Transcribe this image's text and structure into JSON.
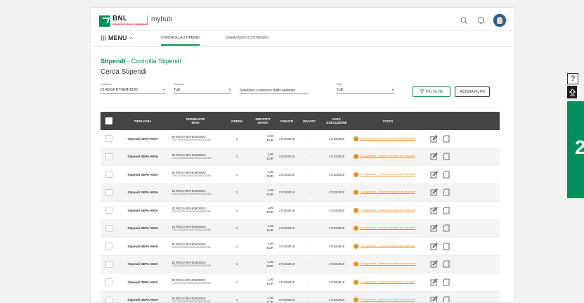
{
  "header": {
    "logo_text": "BNL",
    "logo_sub": "GRUPPO BNP PARIBAS",
    "app_name": "myhub",
    "icons": [
      "search-icon",
      "bell-icon",
      "avatar"
    ]
  },
  "nav": {
    "menu_label": "MENU",
    "tabs": [
      {
        "label": "CONTROLLA STIPENDI",
        "active": true
      },
      {
        "label": "CREA NUOVO STIPENDIO",
        "active": false
      }
    ]
  },
  "page": {
    "breadcrumb_main": "Stipendi",
    "breadcrumb_sub": "- Controlla Stipendi",
    "heading": "Cerca Stipendi"
  },
  "filters": {
    "ordinante_label": "Ordinante",
    "ordinante_value": "DI REGA BYHEMOBJO",
    "tipologia_label": "Tipologia",
    "tipologia_value": "Tutti",
    "iban_placeholder": "Seleziona o inserisci IBAN addebito",
    "stato_label": "Stato",
    "stato_value": "Tutti",
    "more_filters": "PIÙ FILTRI",
    "reset": "AZZERA FILTRI"
  },
  "table": {
    "columns": [
      "TIPOLOGIA",
      "ORDINANTE IBAN",
      "ORDINI",
      "IMPORTO DIVISA",
      "CREATO",
      "INVIATO",
      "DATA ESECUZIONE",
      "STATO"
    ],
    "column_lines": [
      [
        "TIPOLOGIA"
      ],
      [
        "ORDINANTE",
        "IBAN"
      ],
      [
        "ORDINI"
      ],
      [
        "IMPORTO",
        "DIVISA"
      ],
      [
        "CREATO"
      ],
      [
        "INVIATO"
      ],
      [
        "DATA",
        "ESECUZIONE"
      ],
      [
        "STATO"
      ]
    ],
    "rows": [
      {
        "tipologia": "Stipendi SEPA HIGH",
        "ordinante": "DI REGA BYHEMOBJO",
        "iban": "IT92X0105920000000000002256",
        "ordini": "1",
        "importo": "1,00",
        "divisa": "EUR",
        "creato": "17/10/2019",
        "inviato": "-",
        "esecuzione": "17/10/2019",
        "stato": "Da approvare - presenti anomalie non bloccanti"
      },
      {
        "tipologia": "Stipendi SEPA HIGH",
        "ordinante": "DI REGA BYHEMOBJO",
        "iban": "IT92X0105920000000000002256",
        "ordini": "1",
        "importo": "1,00",
        "divisa": "EUR",
        "creato": "17/10/2019",
        "inviato": "-",
        "esecuzione": "17/10/2019",
        "stato": "Da approvare - presenti anomalie non bloccanti"
      },
      {
        "tipologia": "Stipendi SEPA HIGH",
        "ordinante": "DI REGA BYHEMOBJO",
        "iban": "IT92X0105920000000000002256",
        "ordini": "1",
        "importo": "1,00",
        "divisa": "EUR",
        "creato": "17/10/2019",
        "inviato": "-",
        "esecuzione": "17/10/2019",
        "stato": "Da approvare - presenti anomalie non bloccanti"
      },
      {
        "tipologia": "Stipendi SEPA HIGH",
        "ordinante": "DI REGA BYHEMOBJO",
        "iban": "IT92X0105920000000000002256",
        "ordini": "1",
        "importo": "1,00",
        "divisa": "EUR",
        "creato": "17/10/2019",
        "inviato": "-",
        "esecuzione": "17/10/2019",
        "stato": "Da approvare - presenti anomalie non bloccanti"
      },
      {
        "tipologia": "Stipendi SEPA HIGH",
        "ordinante": "DI REGA BYHEMOBJO",
        "iban": "IT92X0105920000000000002256",
        "ordini": "1",
        "importo": "1,00",
        "divisa": "EUR",
        "creato": "17/10/2019",
        "inviato": "-",
        "esecuzione": "17/10/2019",
        "stato": "Da approvare - presenti anomalie non bloccanti"
      },
      {
        "tipologia": "Stipendi SEPA HIGH",
        "ordinante": "DI REGA BYHEMOBJO",
        "iban": "IT92X0105920000000000002256",
        "ordini": "1",
        "importo": "1,00",
        "divisa": "EUR",
        "creato": "17/10/2019",
        "inviato": "-",
        "esecuzione": "17/10/2019",
        "stato": "Da approvare - presenti anomalie non bloccanti"
      },
      {
        "tipologia": "Stipendi SEPA HIGH",
        "ordinante": "DI REGA BYHEMOBJO",
        "iban": "IT92X0105920000000000002256",
        "ordini": "1",
        "importo": "1,00",
        "divisa": "EUR",
        "creato": "17/10/2019",
        "inviato": "-",
        "esecuzione": "17/10/2019",
        "stato": "Da approvare - presenti anomalie non bloccanti"
      },
      {
        "tipologia": "Stipendi SEPA HIGH",
        "ordinante": "DI REGA BYHEMOBJO",
        "iban": "IT92X0105920000000000002256",
        "ordini": "1",
        "importo": "1,00",
        "divisa": "EUR",
        "creato": "17/10/2019",
        "inviato": "-",
        "esecuzione": "17/10/2019",
        "stato": "Da approvare - presenti anomalie non bloccanti"
      },
      {
        "tipologia": "Stipendi SEPA HIGH",
        "ordinante": "DI REGA BYHEMOBJO",
        "iban": "IT92X0105920000000000002256",
        "ordini": "1",
        "importo": "1,00",
        "divisa": "EUR",
        "creato": "17/10/2019",
        "inviato": "-",
        "esecuzione": "17/10/2019",
        "stato": "Da approvare - presenti anomalie non bloccanti"
      },
      {
        "tipologia": "Stipendi SEPA HIGH",
        "ordinante": "DI REGA BYHEMOBJO",
        "iban": "IT92X0105920000000000002256",
        "ordini": "1",
        "importo": "1,00",
        "divisa": "EUR",
        "creato": "17/10/2019",
        "inviato": "-",
        "esecuzione": "17/10/2019",
        "stato": "Da approvare - presenti anomalie non bloccanti"
      }
    ]
  },
  "side_widget": {
    "help": "?",
    "badge": "2"
  },
  "colors": {
    "brand_green": "#00915a",
    "header_dark": "#444444",
    "warning_orange": "#f08c1b"
  }
}
